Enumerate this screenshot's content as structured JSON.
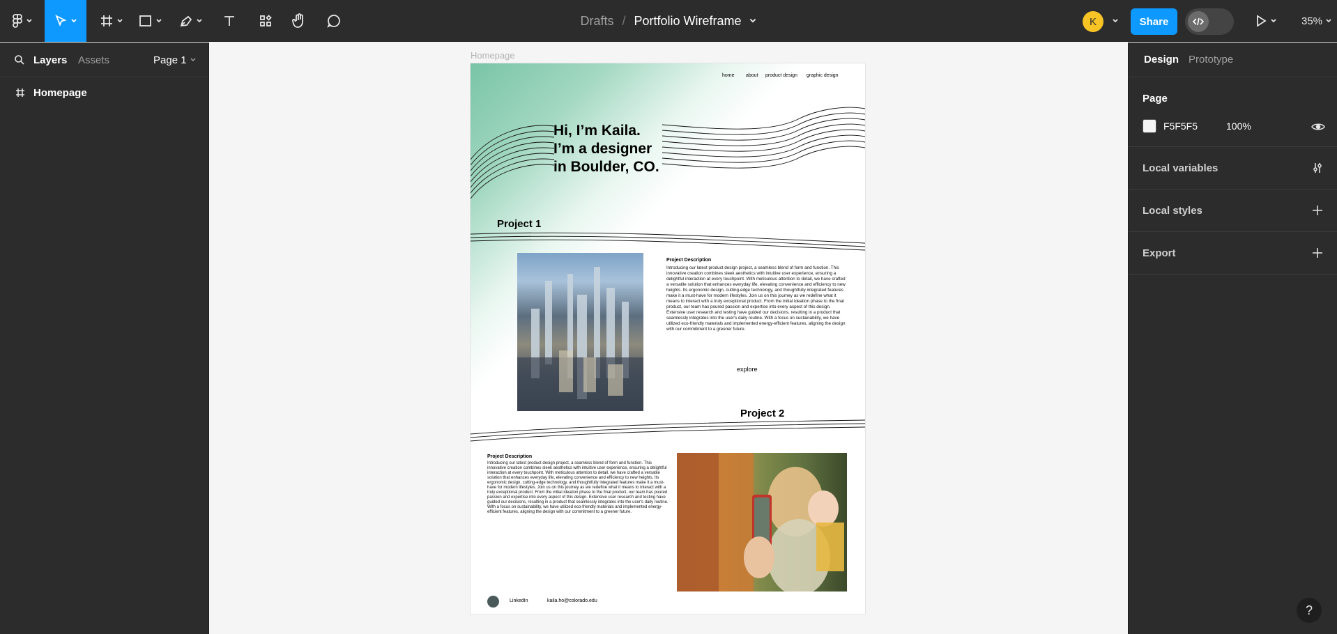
{
  "toolbar": {
    "tools": [
      "main-menu",
      "move",
      "frame",
      "shape",
      "pen",
      "text",
      "components",
      "hand",
      "comment"
    ],
    "active_tool": "move"
  },
  "breadcrumb": {
    "drafts": "Drafts",
    "separator": "/",
    "file": "Portfolio Wireframe"
  },
  "user": {
    "initial": "K",
    "color": "#f7c325"
  },
  "share_label": "Share",
  "zoom": "35%",
  "left_panel": {
    "tabs": [
      "Layers",
      "Assets"
    ],
    "page_selector": "Page 1",
    "layers": [
      {
        "name": "Homepage"
      }
    ]
  },
  "right_panel": {
    "tabs": [
      "Design",
      "Prototype"
    ],
    "page_section": "Page",
    "page_color": "F5F5F5",
    "page_opacity": "100%",
    "local_variables": "Local variables",
    "local_styles": "Local styles",
    "export": "Export"
  },
  "canvas": {
    "frame_label": "Homepage",
    "nav": [
      "home",
      "about",
      "product design",
      "graphic design"
    ],
    "hero": [
      "Hi, I’m Kaila.",
      "I’m a designer",
      "in Boulder, CO."
    ],
    "project1": {
      "title": "Project 1",
      "desc_title": "Project Description",
      "desc": "Introducing our latest product design project, a seamless blend of form and function. This innovative creation combines sleek aesthetics with intuitive user experience, ensuring a delightful interaction at every touchpoint. With meticulous attention to detail, we have crafted a versatile solution that enhances everyday life, elevating convenience and efficiency to new heights. Its ergonomic design, cutting-edge technology, and thoughtfully integrated features make it a must-have for modern lifestyles. Join us on this journey as we redefine what it means to interact with a truly exceptional product. From the initial ideation phase to the final product, our team has poured passion and expertise into every aspect of this design. Extensive user research and testing have guided our decisions, resulting in a product that seamlessly integrates into the user's daily routine. With a focus on sustainability, we have utilized eco-friendly materials and implemented energy-efficient features, aligning the design with our commitment to a greener future.",
      "explore": "explore"
    },
    "project2": {
      "title": "Project 2",
      "desc_title": "Project Description",
      "desc": "Introducing our latest product design project, a seamless blend of form and function. This innovative creation combines sleek aesthetics with intuitive user experience, ensuring a delightful interaction at every touchpoint. With meticulous attention to detail, we have crafted a versatile solution that enhances everyday life, elevating convenience and efficiency to new heights. Its ergonomic design, cutting-edge technology, and thoughtfully integrated features make it a must-have for modern lifestyles. Join us on this journey as we redefine what it means to interact with a truly exceptional product. From the initial ideation phase to the final product, our team has poured passion and expertise into every aspect of this design. Extensive user research and testing have guided our decisions, resulting in a product that seamlessly integrates into the user's daily routine. With a focus on sustainability, we have utilized eco-friendly materials and implemented energy-efficient features, aligning the design with our commitment to a greener future."
    },
    "footer": {
      "linkedin": "LinkedIn",
      "email": "kaila.ho@colorado.edu"
    }
  },
  "colors": {
    "accent": "#0d99ff",
    "chrome": "#2c2c2c",
    "gradient": "#79c4a7"
  }
}
